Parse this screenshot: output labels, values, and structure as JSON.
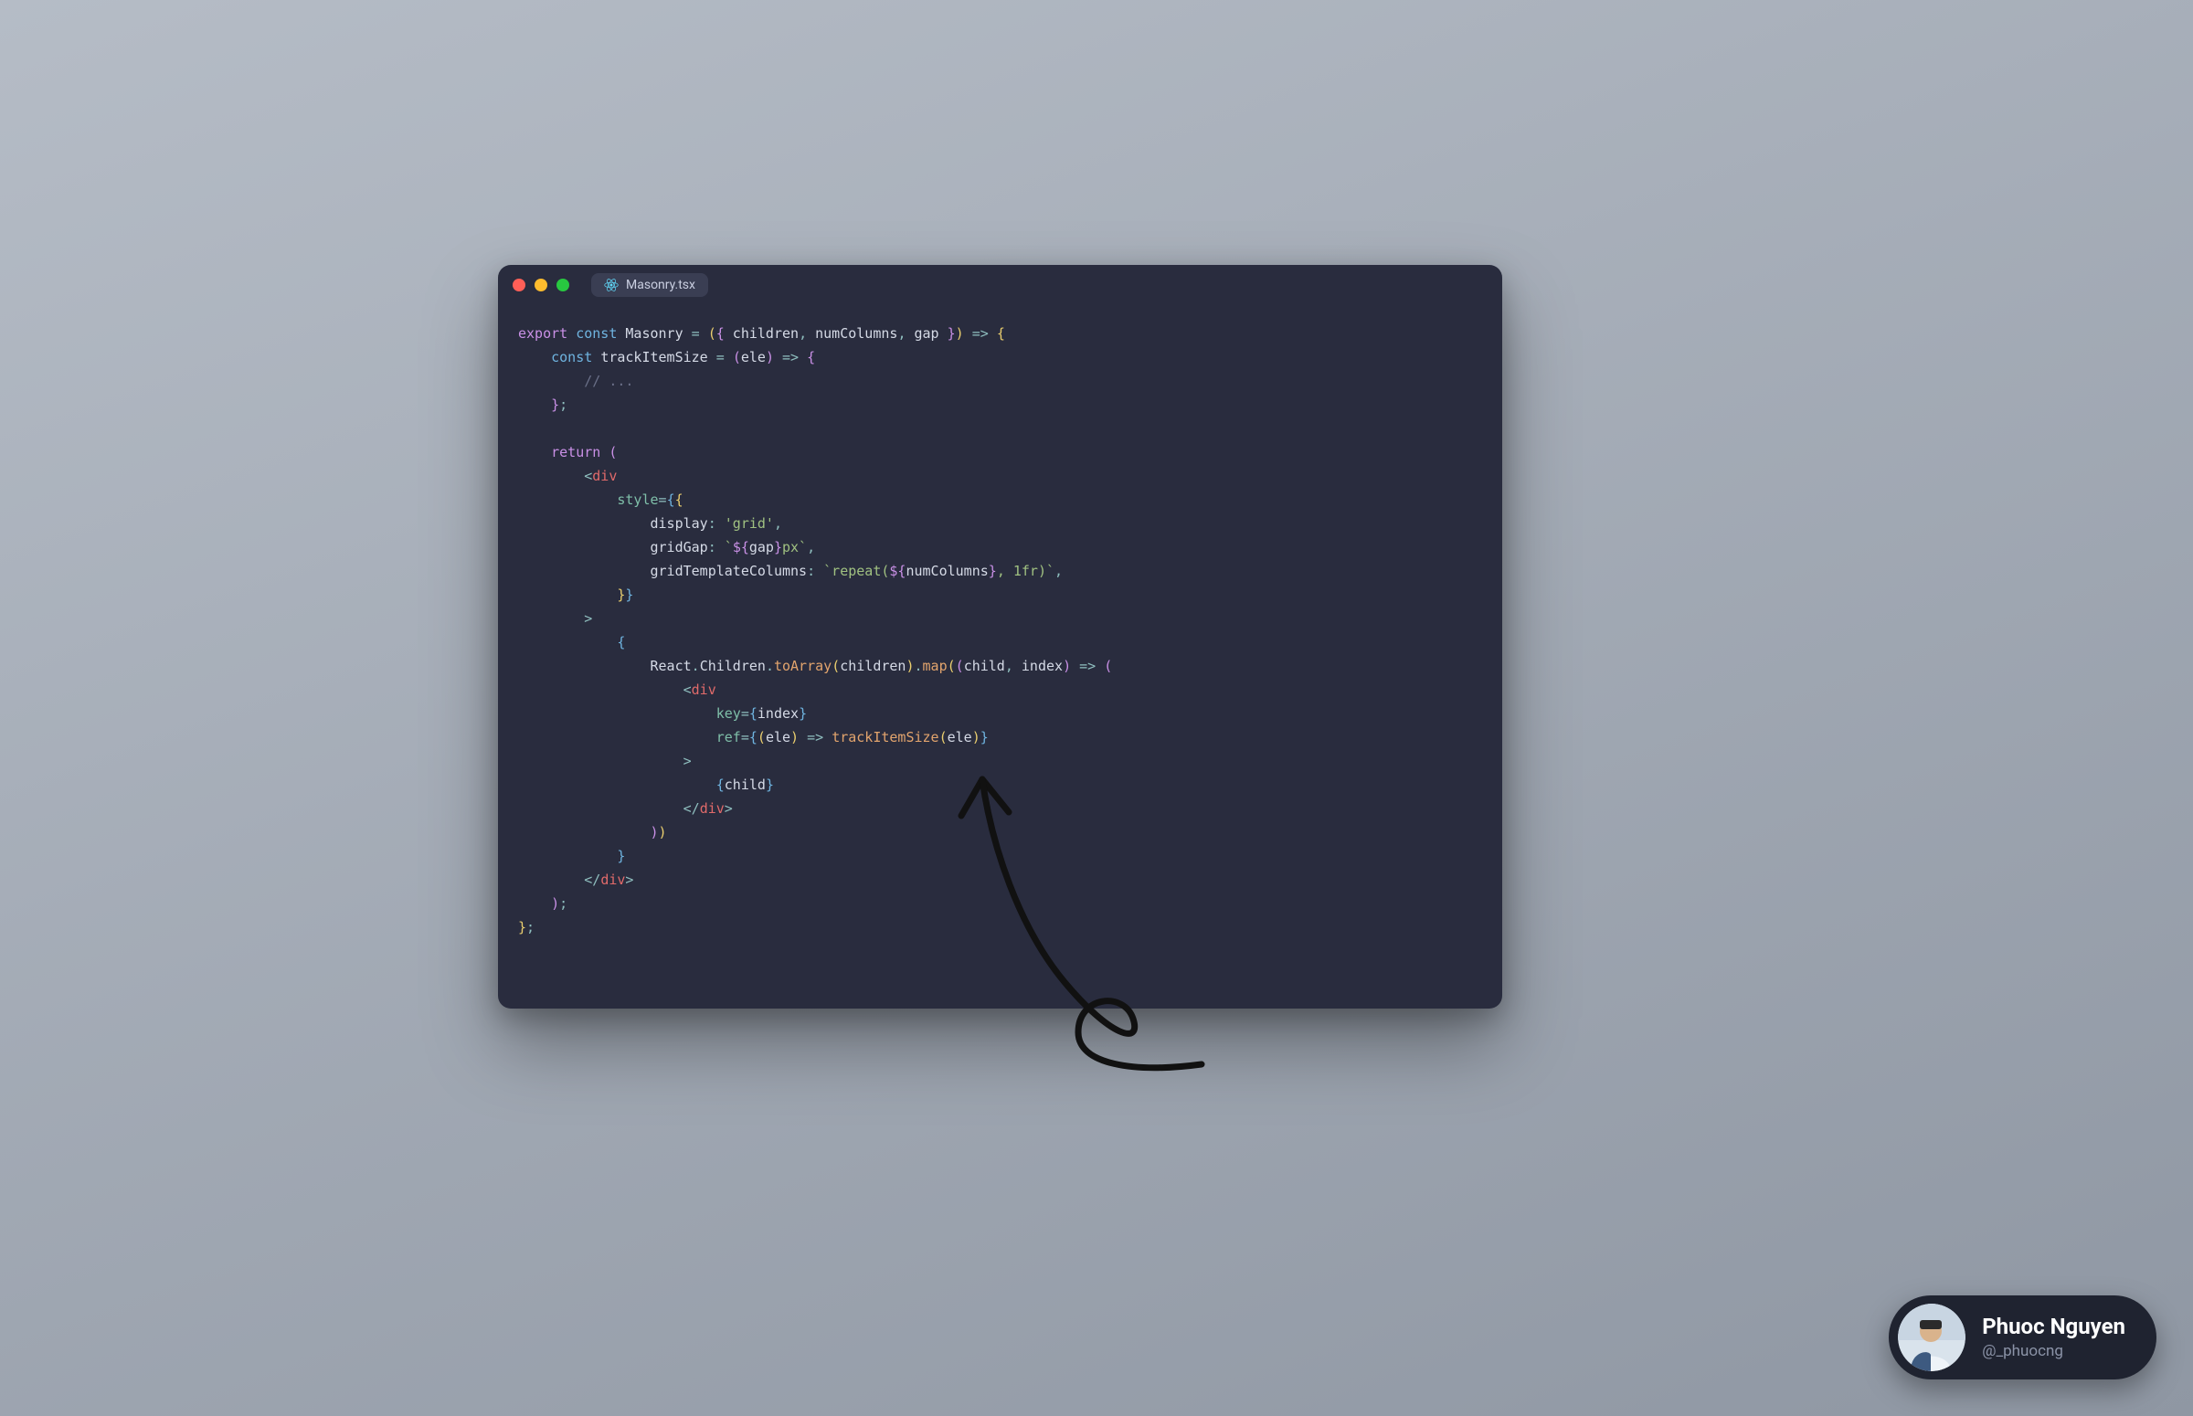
{
  "tab": {
    "filename": "Masonry.tsx"
  },
  "author": {
    "name": "Phuoc Nguyen",
    "handle": "@_phuocng"
  },
  "code": {
    "tokens": [
      [
        [
          "export ",
          "purple"
        ],
        [
          "const ",
          "blue"
        ],
        [
          "Masonry",
          "white"
        ],
        [
          " = ",
          "cyan"
        ],
        [
          "(",
          "yellow"
        ],
        [
          "{",
          "purple"
        ],
        [
          " children",
          "white"
        ],
        [
          ",",
          "cyan"
        ],
        [
          " numColumns",
          "white"
        ],
        [
          ",",
          "cyan"
        ],
        [
          " gap ",
          "white"
        ],
        [
          "}",
          "purple"
        ],
        [
          ")",
          "yellow"
        ],
        [
          " => ",
          "cyan"
        ],
        [
          "{",
          "yellow"
        ]
      ],
      [
        [
          "    ",
          "white"
        ],
        [
          "const ",
          "blue"
        ],
        [
          "trackItemSize",
          "white"
        ],
        [
          " = ",
          "cyan"
        ],
        [
          "(",
          "purple"
        ],
        [
          "ele",
          "white"
        ],
        [
          ")",
          "purple"
        ],
        [
          " => ",
          "cyan"
        ],
        [
          "{",
          "purple"
        ]
      ],
      [
        [
          "        ",
          "white"
        ],
        [
          "// ...",
          "comment"
        ]
      ],
      [
        [
          "    ",
          "white"
        ],
        [
          "}",
          "purple"
        ],
        [
          ";",
          "cyan"
        ]
      ],
      [
        [
          "",
          "white"
        ]
      ],
      [
        [
          "    ",
          "white"
        ],
        [
          "return ",
          "purple"
        ],
        [
          "(",
          "purple"
        ]
      ],
      [
        [
          "        ",
          "white"
        ],
        [
          "<",
          "cyan"
        ],
        [
          "div",
          "red"
        ]
      ],
      [
        [
          "            ",
          "white"
        ],
        [
          "style",
          "teal"
        ],
        [
          "=",
          "cyan"
        ],
        [
          "{",
          "blue"
        ],
        [
          "{",
          "yellow"
        ]
      ],
      [
        [
          "                ",
          "white"
        ],
        [
          "display",
          "white"
        ],
        [
          ": ",
          "cyan"
        ],
        [
          "'grid'",
          "green"
        ],
        [
          ",",
          "cyan"
        ]
      ],
      [
        [
          "                ",
          "white"
        ],
        [
          "gridGap",
          "white"
        ],
        [
          ": ",
          "cyan"
        ],
        [
          "`",
          "green"
        ],
        [
          "${",
          "purple"
        ],
        [
          "gap",
          "white"
        ],
        [
          "}",
          "purple"
        ],
        [
          "px`",
          "green"
        ],
        [
          ",",
          "cyan"
        ]
      ],
      [
        [
          "                ",
          "white"
        ],
        [
          "gridTemplateColumns",
          "white"
        ],
        [
          ": ",
          "cyan"
        ],
        [
          "`repeat(",
          "green"
        ],
        [
          "${",
          "purple"
        ],
        [
          "numColumns",
          "white"
        ],
        [
          "}",
          "purple"
        ],
        [
          ", 1fr)`",
          "green"
        ],
        [
          ",",
          "cyan"
        ]
      ],
      [
        [
          "            ",
          "white"
        ],
        [
          "}",
          "yellow"
        ],
        [
          "}",
          "blue"
        ]
      ],
      [
        [
          "        ",
          "white"
        ],
        [
          ">",
          "cyan"
        ]
      ],
      [
        [
          "            ",
          "white"
        ],
        [
          "{",
          "blue"
        ]
      ],
      [
        [
          "                ",
          "white"
        ],
        [
          "React",
          "white"
        ],
        [
          ".",
          "cyan"
        ],
        [
          "Children",
          "white"
        ],
        [
          ".",
          "cyan"
        ],
        [
          "toArray",
          "orange"
        ],
        [
          "(",
          "yellow"
        ],
        [
          "children",
          "white"
        ],
        [
          ")",
          "yellow"
        ],
        [
          ".",
          "cyan"
        ],
        [
          "map",
          "orange"
        ],
        [
          "(",
          "yellow"
        ],
        [
          "(",
          "purple"
        ],
        [
          "child",
          "white"
        ],
        [
          ",",
          "cyan"
        ],
        [
          " index",
          "white"
        ],
        [
          ")",
          "purple"
        ],
        [
          " => ",
          "cyan"
        ],
        [
          "(",
          "purple"
        ]
      ],
      [
        [
          "                    ",
          "white"
        ],
        [
          "<",
          "cyan"
        ],
        [
          "div",
          "red"
        ]
      ],
      [
        [
          "                        ",
          "white"
        ],
        [
          "key",
          "teal"
        ],
        [
          "=",
          "cyan"
        ],
        [
          "{",
          "blue"
        ],
        [
          "index",
          "white"
        ],
        [
          "}",
          "blue"
        ]
      ],
      [
        [
          "                        ",
          "white"
        ],
        [
          "ref",
          "teal"
        ],
        [
          "=",
          "cyan"
        ],
        [
          "{",
          "blue"
        ],
        [
          "(",
          "yellow"
        ],
        [
          "ele",
          "white"
        ],
        [
          ")",
          "yellow"
        ],
        [
          " => ",
          "cyan"
        ],
        [
          "trackItemSize",
          "orange"
        ],
        [
          "(",
          "yellow"
        ],
        [
          "ele",
          "white"
        ],
        [
          ")",
          "yellow"
        ],
        [
          "}",
          "blue"
        ]
      ],
      [
        [
          "                    ",
          "white"
        ],
        [
          ">",
          "cyan"
        ]
      ],
      [
        [
          "                        ",
          "white"
        ],
        [
          "{",
          "blue"
        ],
        [
          "child",
          "white"
        ],
        [
          "}",
          "blue"
        ]
      ],
      [
        [
          "                    ",
          "white"
        ],
        [
          "</",
          "cyan"
        ],
        [
          "div",
          "red"
        ],
        [
          ">",
          "cyan"
        ]
      ],
      [
        [
          "                ",
          "white"
        ],
        [
          ")",
          "purple"
        ],
        [
          ")",
          "yellow"
        ]
      ],
      [
        [
          "            ",
          "white"
        ],
        [
          "}",
          "blue"
        ]
      ],
      [
        [
          "        ",
          "white"
        ],
        [
          "</",
          "cyan"
        ],
        [
          "div",
          "red"
        ],
        [
          ">",
          "cyan"
        ]
      ],
      [
        [
          "    ",
          "white"
        ],
        [
          ")",
          "purple"
        ],
        [
          ";",
          "cyan"
        ]
      ],
      [
        [
          "}",
          "yellow"
        ],
        [
          ";",
          "cyan"
        ]
      ]
    ]
  }
}
